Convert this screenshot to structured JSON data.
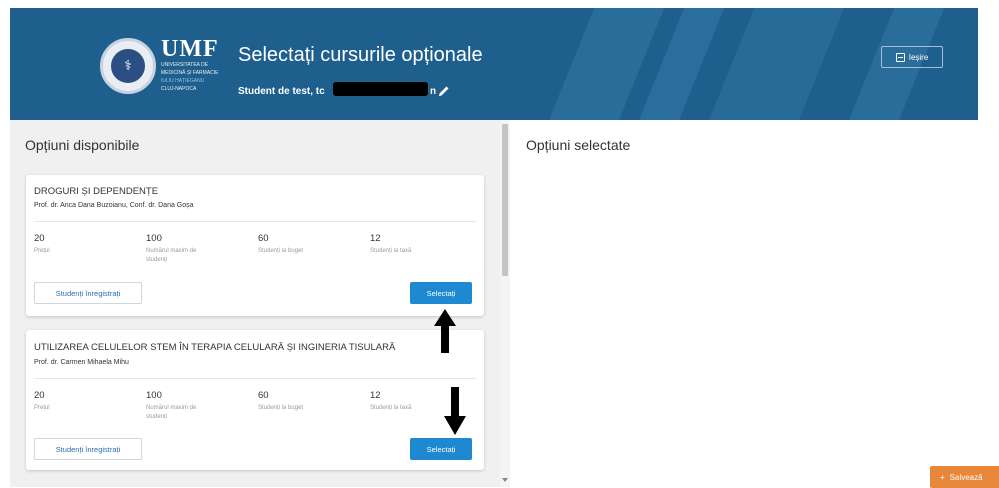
{
  "header": {
    "logo_abbr": "UMF",
    "logo_lines": [
      "UNIVERSITATEA DE",
      "MEDICINĂ ȘI FARMACIE",
      "IULIU HAȚIEGANU",
      "CLUJ-NAPOCA"
    ],
    "title": "Selectați cursurile opționale",
    "student_label": "Student de test, tc",
    "student_suffix": "n",
    "exit_label": "Ieșire",
    "colors": {
      "background": "#1f5f8d",
      "accent": "#1e88d0"
    }
  },
  "left_panel": {
    "title": "Opțiuni disponibile",
    "courses": [
      {
        "title": "DROGURI ȘI DEPENDENȚE",
        "professors": "Prof. dr. Anca Dana Buzoianu, Conf. dr. Dana Goșa",
        "stats": [
          {
            "value": "20",
            "label": "Prețul"
          },
          {
            "value": "100",
            "label": "Numărul maxim de studenți"
          },
          {
            "value": "60",
            "label": "Studenți la buget"
          },
          {
            "value": "12",
            "label": "Studenți la taxă"
          }
        ],
        "registered_button": "Studenți înregistrați",
        "select_button": "Selectați"
      },
      {
        "title": "UTILIZAREA CELULELOR STEM ÎN TERAPIA CELULARĂ ȘI INGINERIA TISULARĂ",
        "professors": "Prof. dr. Carmen Mihaela Mihu",
        "stats": [
          {
            "value": "20",
            "label": "Prețul"
          },
          {
            "value": "100",
            "label": "Numărul maxim de studenți"
          },
          {
            "value": "60",
            "label": "Studenți la buget"
          },
          {
            "value": "12",
            "label": "Studenți la taxă"
          }
        ],
        "registered_button": "Studenți înregistrați",
        "select_button": "Selectați"
      }
    ]
  },
  "right_panel": {
    "title": "Opțiuni selectate"
  },
  "save_button": {
    "label": "Salvează",
    "color": "#e8863a"
  }
}
